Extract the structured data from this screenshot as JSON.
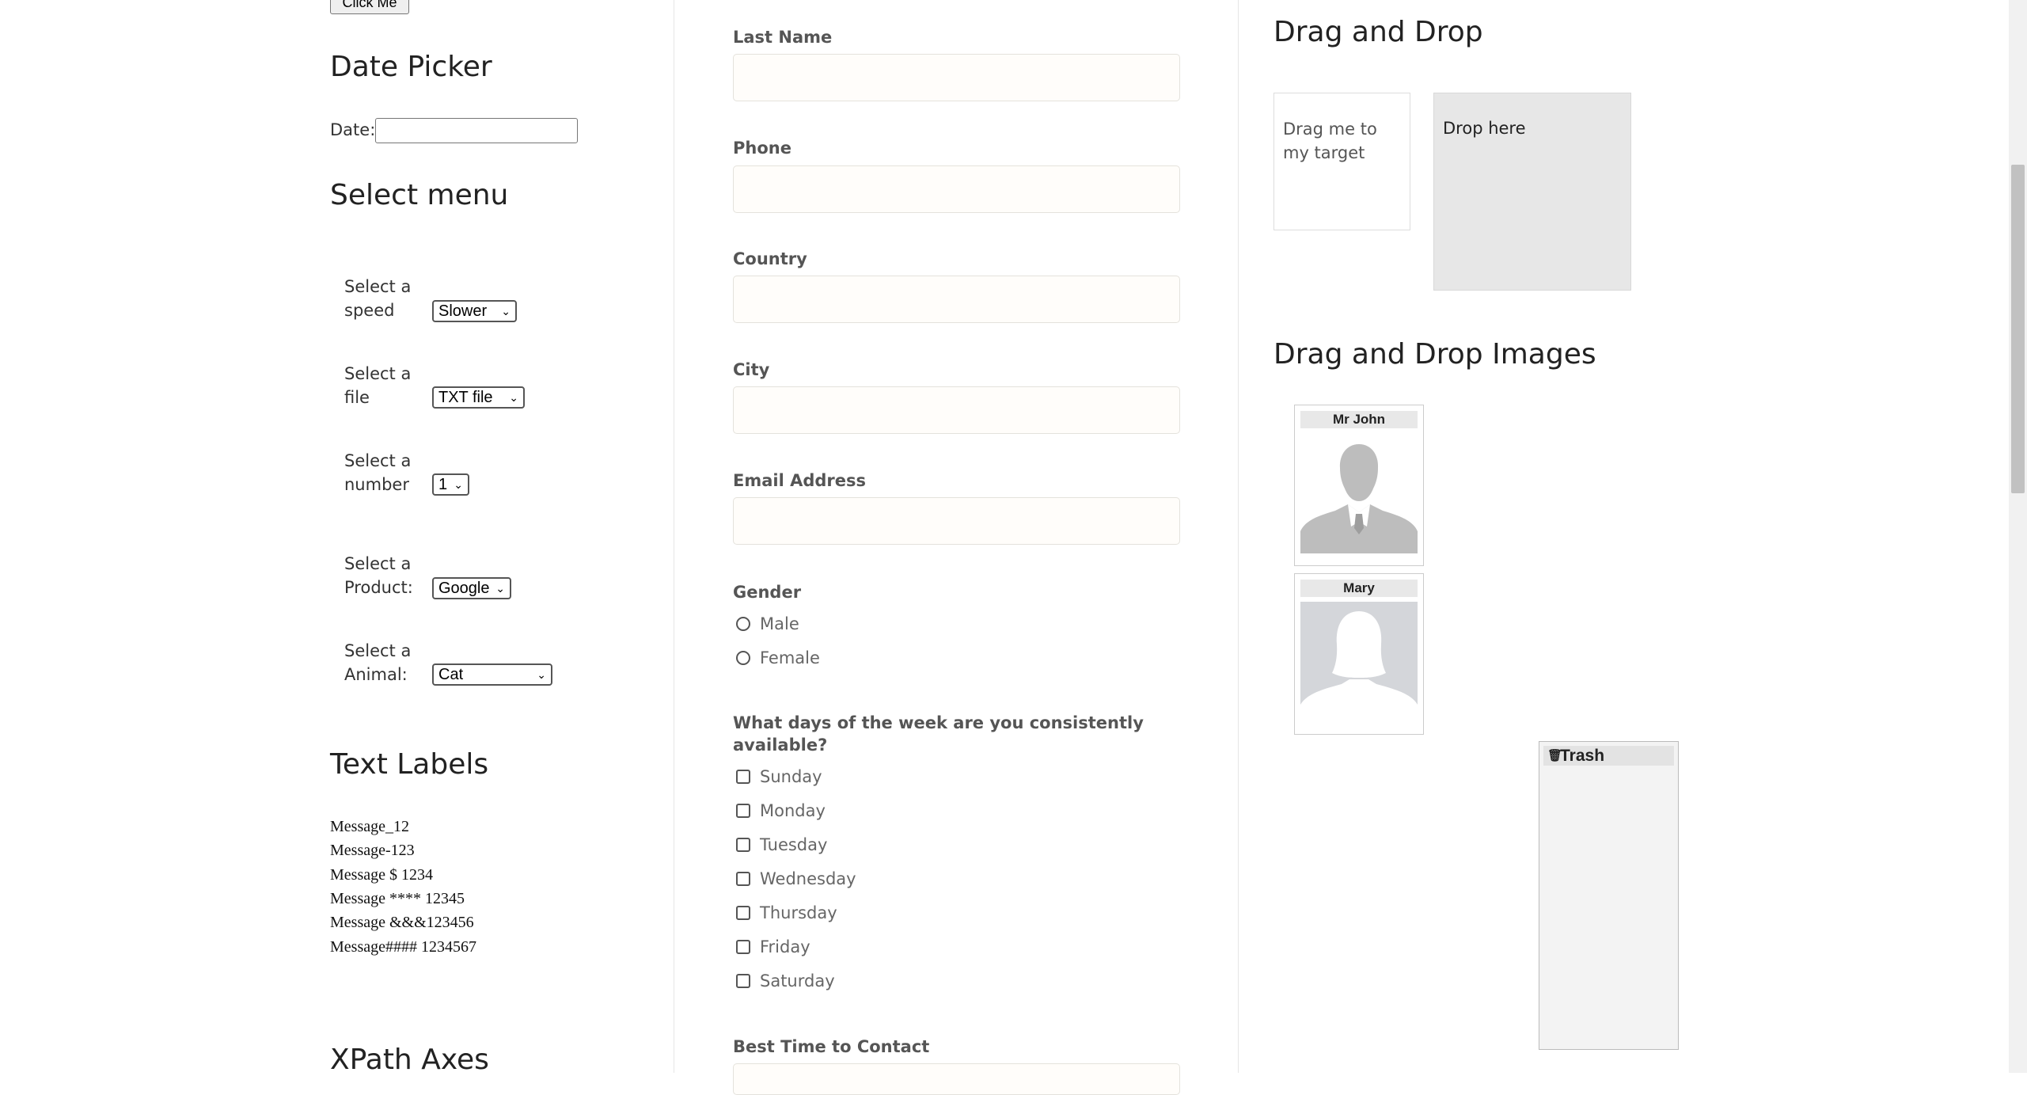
{
  "left": {
    "click_button_label": "Click Me",
    "date_picker": {
      "heading": "Date Picker",
      "date_label": "Date:",
      "date_value": ""
    },
    "select_menu": {
      "heading": "Select menu",
      "rows": [
        {
          "label_line1": "Select a",
          "label_line2": "speed",
          "value": "Slower"
        },
        {
          "label_line1": "Select a",
          "label_line2": "file",
          "value": "TXT file"
        },
        {
          "label_line1": "Select a",
          "label_line2": "number",
          "value": "1"
        },
        {
          "label_line1": "Select a",
          "label_line2": "Product:",
          "value": "Google"
        },
        {
          "label_line1": "Select a",
          "label_line2": "Animal:",
          "value": "Cat"
        }
      ]
    },
    "text_labels": {
      "heading": "Text Labels",
      "messages": [
        "Message_12",
        "Message-123",
        "Message $ 1234",
        "Message **** 12345",
        "Message &&&123456",
        "Message#### 1234567"
      ]
    },
    "xpath_heading": "XPath Axes"
  },
  "form": {
    "last_name_label": "Last Name",
    "phone_label": "Phone",
    "country_label": "Country",
    "city_label": "City",
    "email_label": "Email Address",
    "gender_label": "Gender",
    "gender_options": [
      "Male",
      "Female"
    ],
    "days_question_line1": "What days of the week are you consistently",
    "days_question_line2": "available?",
    "days": [
      "Sunday",
      "Monday",
      "Tuesday",
      "Wednesday",
      "Thursday",
      "Friday",
      "Saturday"
    ],
    "best_time_label": "Best Time to Contact"
  },
  "right": {
    "drag_drop": {
      "heading": "Drag and Drop",
      "drag_text": "Drag me to my target",
      "drop_text": "Drop here"
    },
    "drag_drop_images": {
      "heading": "Drag and Drop Images",
      "cards": [
        {
          "name": "Mr John",
          "icon": "male-avatar-icon"
        },
        {
          "name": "Mary",
          "icon": "female-avatar-icon"
        }
      ],
      "trash_label": "Trash"
    }
  }
}
